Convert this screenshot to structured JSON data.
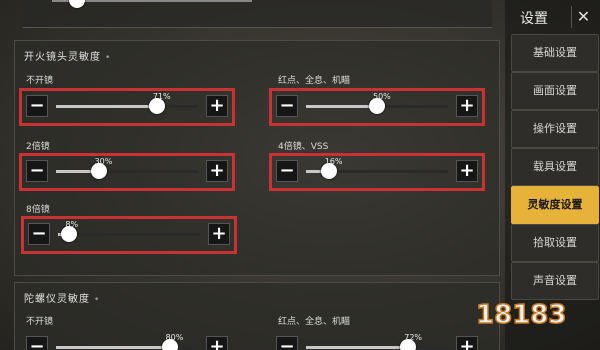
{
  "header": {
    "title": "设置",
    "close_label": "✕"
  },
  "sidebar": {
    "items": [
      {
        "label": "基础设置",
        "active": false
      },
      {
        "label": "画面设置",
        "active": false
      },
      {
        "label": "操作设置",
        "active": false
      },
      {
        "label": "载具设置",
        "active": false
      },
      {
        "label": "灵敏度设置",
        "active": true
      },
      {
        "label": "拾取设置",
        "active": false
      },
      {
        "label": "声音设置",
        "active": false
      }
    ]
  },
  "sections": {
    "fire_scope": {
      "title": "开火镜头灵敏度",
      "sliders": [
        {
          "label": "不开镜",
          "value_text": "71%",
          "value": 71
        },
        {
          "label": "红点、全息、机瞄",
          "value_text": "50%",
          "value": 50
        },
        {
          "label": "2倍镜",
          "value_text": "30%",
          "value": 30
        },
        {
          "label": "4倍镜、VSS",
          "value_text": "16%",
          "value": 16
        },
        {
          "label": "8倍镜",
          "value_text": "8%",
          "value": 8
        }
      ]
    },
    "gyro": {
      "title": "陀螺仪灵敏度",
      "sliders": [
        {
          "label": "不开镜",
          "value_text": "80%",
          "value": 80
        },
        {
          "label": "红点、全息、机瞄",
          "value_text": "72%",
          "value": 72
        }
      ]
    }
  },
  "buttons": {
    "minus": "−",
    "plus": "+"
  },
  "watermark": {
    "text": "18183"
  },
  "colors": {
    "accent": "#e7b23a",
    "highlight": "#c83232"
  }
}
